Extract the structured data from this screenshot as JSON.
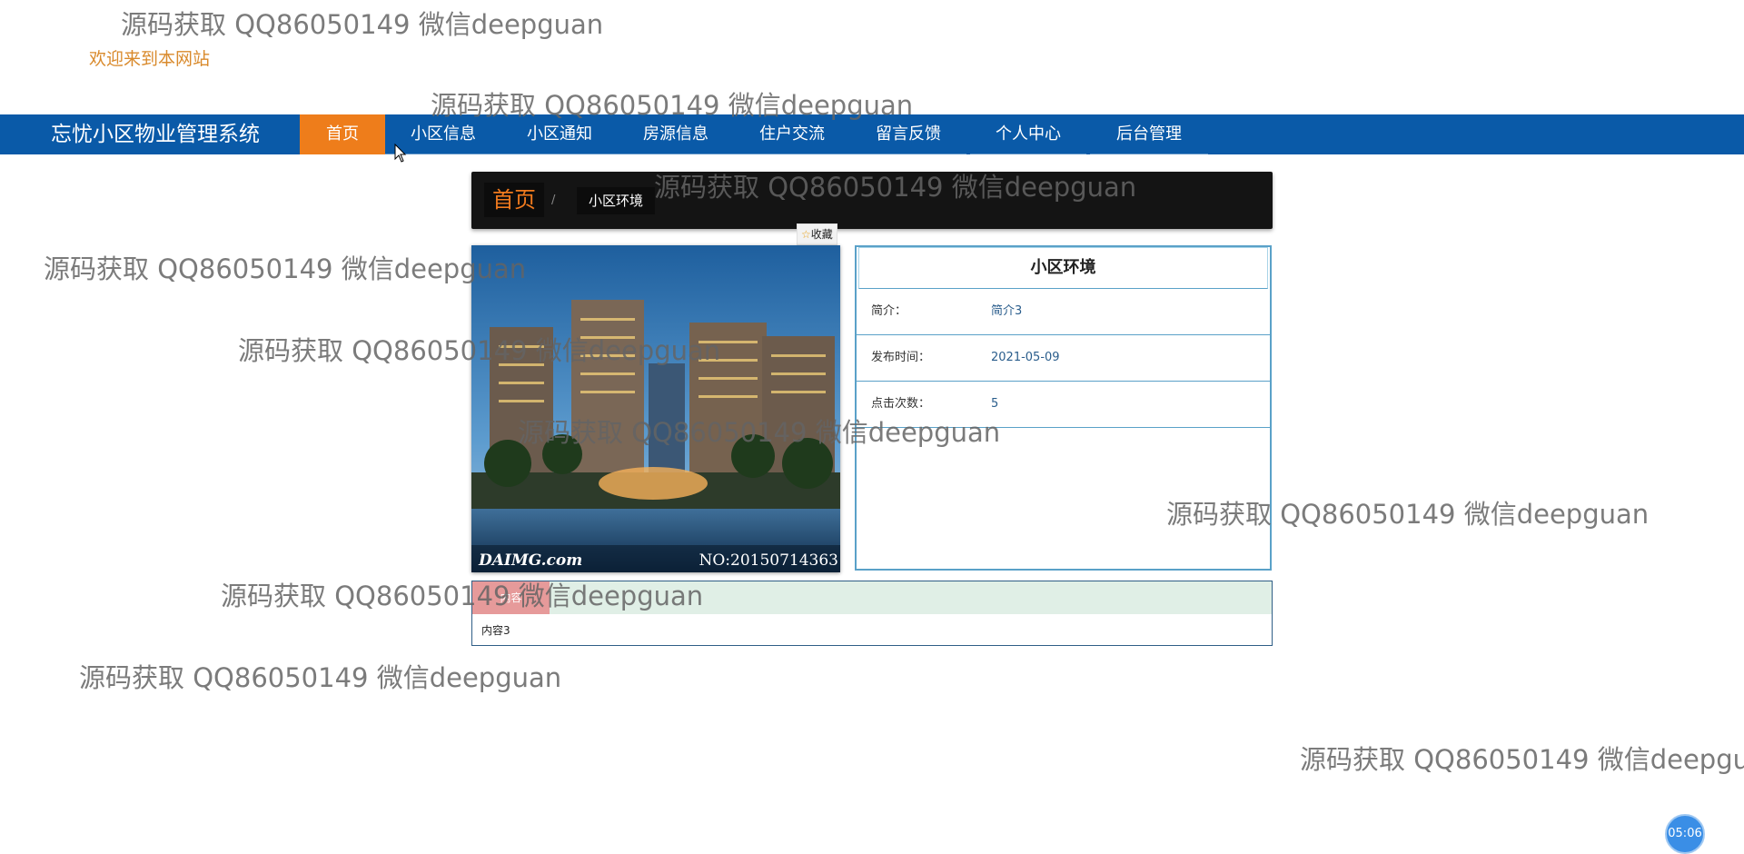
{
  "welcome": "欢迎来到本网站",
  "nav": {
    "brand": "忘忧小区物业管理系统",
    "items": [
      "首页",
      "小区信息",
      "小区通知",
      "房源信息",
      "住户交流",
      "留言反馈",
      "个人中心",
      "后台管理"
    ],
    "active": "首页",
    "bar_color": "#0a5aa8",
    "active_color": "#ee7d1b"
  },
  "breadcrumb": {
    "home": "首页",
    "separator": "/",
    "current": "小区环境"
  },
  "collect": {
    "icon": "star-icon",
    "label": "收藏"
  },
  "photo": {
    "alt": "小区环境",
    "watermark_left": "DAIMG.com",
    "watermark_right": "NO:20150714363"
  },
  "info": {
    "title": "小区环境",
    "rows": [
      {
        "label": "简介：",
        "value": "简介3"
      },
      {
        "label": "发布时间：",
        "value": "2021-05-09"
      },
      {
        "label": "点击次数：",
        "value": "5"
      }
    ]
  },
  "content": {
    "tab": "内容",
    "body": "内容3"
  },
  "watermark_text": "源码获取 QQ86050149 微信deepguan",
  "timer": "05:06"
}
